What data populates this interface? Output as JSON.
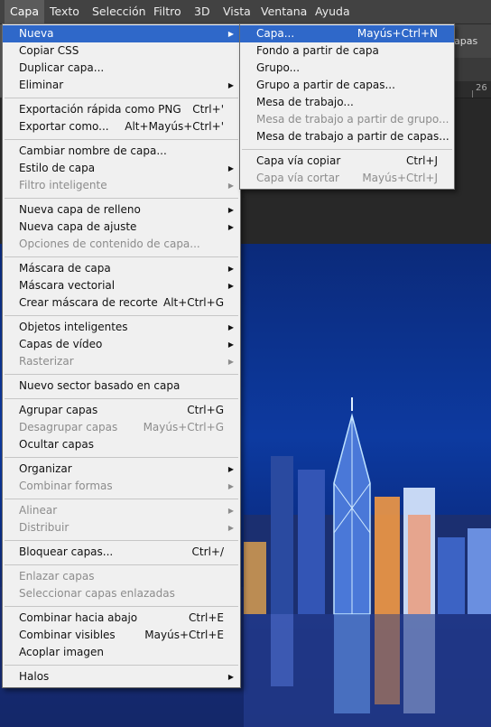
{
  "menubar": [
    "Capa",
    "Texto",
    "Selección",
    "Filtro",
    "3D",
    "Vista",
    "Ventana",
    "Ayuda"
  ],
  "options_bar": {
    "label": "apas"
  },
  "ruler": {
    "number": "26"
  },
  "main_menu": [
    {
      "label": "Nueva",
      "shortcut": "",
      "submenu": true,
      "disabled": false,
      "highlight": true
    },
    {
      "label": "Copiar CSS",
      "shortcut": "",
      "submenu": false,
      "disabled": false
    },
    {
      "label": "Duplicar capa...",
      "shortcut": "",
      "submenu": false,
      "disabled": false
    },
    {
      "label": "Eliminar",
      "shortcut": "",
      "submenu": true,
      "disabled": false
    },
    {
      "sep": true
    },
    {
      "label": "Exportación rápida como PNG",
      "shortcut": "Ctrl+'",
      "submenu": false,
      "disabled": false
    },
    {
      "label": "Exportar como...",
      "shortcut": "Alt+Mayús+Ctrl+'",
      "submenu": false,
      "disabled": false
    },
    {
      "sep": true
    },
    {
      "label": "Cambiar nombre de capa...",
      "shortcut": "",
      "submenu": false,
      "disabled": false
    },
    {
      "label": "Estilo de capa",
      "shortcut": "",
      "submenu": true,
      "disabled": false
    },
    {
      "label": "Filtro inteligente",
      "shortcut": "",
      "submenu": true,
      "disabled": true
    },
    {
      "sep": true
    },
    {
      "label": "Nueva capa de relleno",
      "shortcut": "",
      "submenu": true,
      "disabled": false
    },
    {
      "label": "Nueva capa de ajuste",
      "shortcut": "",
      "submenu": true,
      "disabled": false
    },
    {
      "label": "Opciones de contenido de capa...",
      "shortcut": "",
      "submenu": false,
      "disabled": true
    },
    {
      "sep": true
    },
    {
      "label": "Máscara de capa",
      "shortcut": "",
      "submenu": true,
      "disabled": false
    },
    {
      "label": "Máscara vectorial",
      "shortcut": "",
      "submenu": true,
      "disabled": false
    },
    {
      "label": "Crear máscara de recorte",
      "shortcut": "Alt+Ctrl+G",
      "submenu": false,
      "disabled": false
    },
    {
      "sep": true
    },
    {
      "label": "Objetos inteligentes",
      "shortcut": "",
      "submenu": true,
      "disabled": false
    },
    {
      "label": "Capas de vídeo",
      "shortcut": "",
      "submenu": true,
      "disabled": false
    },
    {
      "label": "Rasterizar",
      "shortcut": "",
      "submenu": true,
      "disabled": true
    },
    {
      "sep": true
    },
    {
      "label": "Nuevo sector basado en capa",
      "shortcut": "",
      "submenu": false,
      "disabled": false
    },
    {
      "sep": true
    },
    {
      "label": "Agrupar capas",
      "shortcut": "Ctrl+G",
      "submenu": false,
      "disabled": false
    },
    {
      "label": "Desagrupar capas",
      "shortcut": "Mayús+Ctrl+G",
      "submenu": false,
      "disabled": true
    },
    {
      "label": "Ocultar capas",
      "shortcut": "",
      "submenu": false,
      "disabled": false
    },
    {
      "sep": true
    },
    {
      "label": "Organizar",
      "shortcut": "",
      "submenu": true,
      "disabled": false
    },
    {
      "label": "Combinar formas",
      "shortcut": "",
      "submenu": true,
      "disabled": true
    },
    {
      "sep": true
    },
    {
      "label": "Alinear",
      "shortcut": "",
      "submenu": true,
      "disabled": true
    },
    {
      "label": "Distribuir",
      "shortcut": "",
      "submenu": true,
      "disabled": true
    },
    {
      "sep": true
    },
    {
      "label": "Bloquear capas...",
      "shortcut": "Ctrl+/",
      "submenu": false,
      "disabled": false
    },
    {
      "sep": true
    },
    {
      "label": "Enlazar capas",
      "shortcut": "",
      "submenu": false,
      "disabled": true
    },
    {
      "label": "Seleccionar capas enlazadas",
      "shortcut": "",
      "submenu": false,
      "disabled": true
    },
    {
      "sep": true
    },
    {
      "label": "Combinar hacia abajo",
      "shortcut": "Ctrl+E",
      "submenu": false,
      "disabled": false
    },
    {
      "label": "Combinar visibles",
      "shortcut": "Mayús+Ctrl+E",
      "submenu": false,
      "disabled": false
    },
    {
      "label": "Acoplar imagen",
      "shortcut": "",
      "submenu": false,
      "disabled": false
    },
    {
      "sep": true
    },
    {
      "label": "Halos",
      "shortcut": "",
      "submenu": true,
      "disabled": false
    }
  ],
  "sub_menu": [
    {
      "label": "Capa...",
      "shortcut": "Mayús+Ctrl+N",
      "disabled": false,
      "highlight": true
    },
    {
      "label": "Fondo a partir de capa",
      "shortcut": "",
      "disabled": false
    },
    {
      "label": "Grupo...",
      "shortcut": "",
      "disabled": false
    },
    {
      "label": "Grupo a partir de capas...",
      "shortcut": "",
      "disabled": false
    },
    {
      "label": "Mesa de trabajo...",
      "shortcut": "",
      "disabled": false
    },
    {
      "label": "Mesa de trabajo a partir de grupo...",
      "shortcut": "",
      "disabled": true
    },
    {
      "label": "Mesa de trabajo a partir de capas...",
      "shortcut": "",
      "disabled": false
    },
    {
      "sep": true
    },
    {
      "label": "Capa vía copiar",
      "shortcut": "Ctrl+J",
      "disabled": false
    },
    {
      "label": "Capa vía cortar",
      "shortcut": "Mayús+Ctrl+J",
      "disabled": true
    }
  ],
  "colors": {
    "highlight": "#2f68c9",
    "menu_bg": "#f0f0f0",
    "menubar_bg": "#424242"
  }
}
